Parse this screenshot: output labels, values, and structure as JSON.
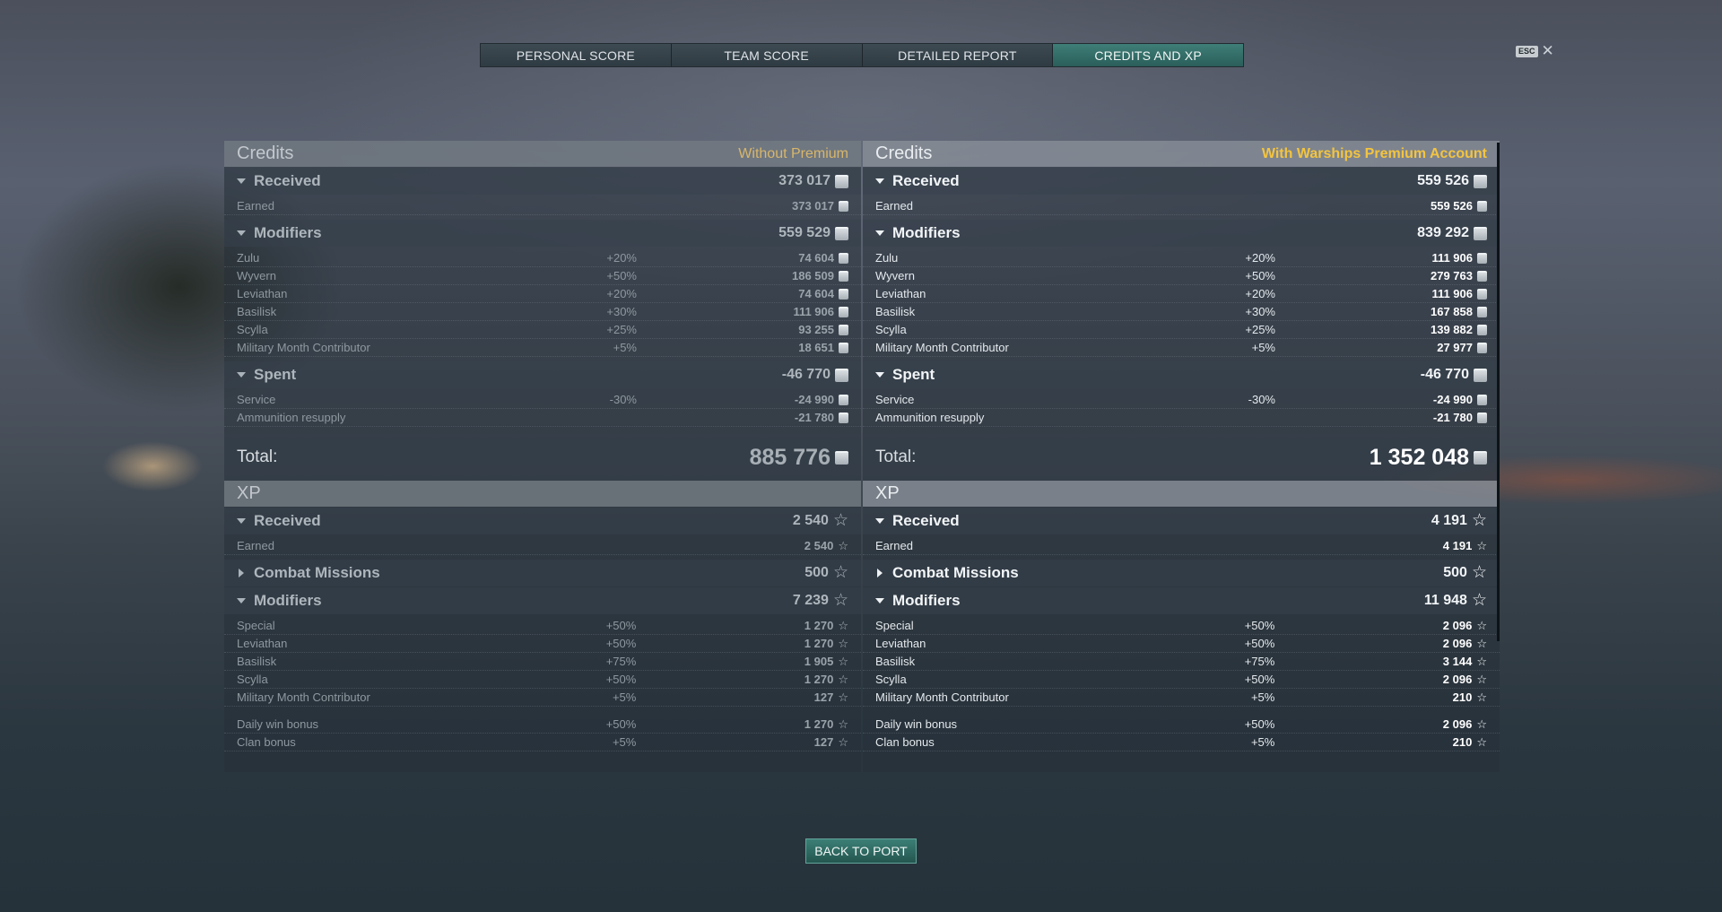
{
  "tabs": [
    {
      "label": "PERSONAL SCORE"
    },
    {
      "label": "TEAM SCORE"
    },
    {
      "label": "DETAILED REPORT"
    },
    {
      "label": "CREDITS AND XP"
    }
  ],
  "esc": {
    "key": "ESC",
    "close": "✕"
  },
  "left": {
    "credits_title": "Credits",
    "credits_note": "Without Premium",
    "received": {
      "label": "Received",
      "value": "373 017"
    },
    "earned": {
      "label": "Earned",
      "value": "373 017"
    },
    "modifiers": {
      "label": "Modifiers",
      "value": "559 529"
    },
    "mods": [
      {
        "label": "Zulu",
        "pct": "+20%",
        "value": "74 604"
      },
      {
        "label": "Wyvern",
        "pct": "+50%",
        "value": "186 509"
      },
      {
        "label": "Leviathan",
        "pct": "+20%",
        "value": "74 604"
      },
      {
        "label": "Basilisk",
        "pct": "+30%",
        "value": "111 906"
      },
      {
        "label": "Scylla",
        "pct": "+25%",
        "value": "93 255"
      },
      {
        "label": "Military Month Contributor",
        "pct": "+5%",
        "value": "18 651"
      }
    ],
    "spent": {
      "label": "Spent",
      "value": "-46 770"
    },
    "spent_rows": [
      {
        "label": "Service",
        "pct": "-30%",
        "value": "-24 990"
      },
      {
        "label": "Ammunition resupply",
        "pct": "",
        "value": "-21 780"
      }
    ],
    "total": {
      "label": "Total:",
      "value": "885 776"
    },
    "xp_title": "XP",
    "xp_received": {
      "label": "Received",
      "value": "2 540"
    },
    "xp_earned": {
      "label": "Earned",
      "value": "2 540"
    },
    "combat": {
      "label": "Combat Missions",
      "value": "500"
    },
    "xp_modifiers": {
      "label": "Modifiers",
      "value": "7 239"
    },
    "xp_mods": [
      {
        "label": "Special",
        "pct": "+50%",
        "value": "1 270"
      },
      {
        "label": "Leviathan",
        "pct": "+50%",
        "value": "1 270"
      },
      {
        "label": "Basilisk",
        "pct": "+75%",
        "value": "1 905"
      },
      {
        "label": "Scylla",
        "pct": "+50%",
        "value": "1 270"
      },
      {
        "label": "Military Month Contributor",
        "pct": "+5%",
        "value": "127"
      }
    ],
    "xp_bonus": [
      {
        "label": "Daily win bonus",
        "pct": "+50%",
        "value": "1 270"
      },
      {
        "label": "Clan bonus",
        "pct": "+5%",
        "value": "127"
      }
    ]
  },
  "right": {
    "credits_title": "Credits",
    "credits_note": "With Warships Premium Account",
    "received": {
      "label": "Received",
      "value": "559 526"
    },
    "earned": {
      "label": "Earned",
      "value": "559 526"
    },
    "modifiers": {
      "label": "Modifiers",
      "value": "839 292"
    },
    "mods": [
      {
        "label": "Zulu",
        "pct": "+20%",
        "value": "111 906"
      },
      {
        "label": "Wyvern",
        "pct": "+50%",
        "value": "279 763"
      },
      {
        "label": "Leviathan",
        "pct": "+20%",
        "value": "111 906"
      },
      {
        "label": "Basilisk",
        "pct": "+30%",
        "value": "167 858"
      },
      {
        "label": "Scylla",
        "pct": "+25%",
        "value": "139 882"
      },
      {
        "label": "Military Month Contributor",
        "pct": "+5%",
        "value": "27 977"
      }
    ],
    "spent": {
      "label": "Spent",
      "value": "-46 770"
    },
    "spent_rows": [
      {
        "label": "Service",
        "pct": "-30%",
        "value": "-24 990"
      },
      {
        "label": "Ammunition resupply",
        "pct": "",
        "value": "-21 780"
      }
    ],
    "total": {
      "label": "Total:",
      "value": "1 352 048"
    },
    "xp_title": "XP",
    "xp_received": {
      "label": "Received",
      "value": "4 191"
    },
    "xp_earned": {
      "label": "Earned",
      "value": "4 191"
    },
    "combat": {
      "label": "Combat Missions",
      "value": "500"
    },
    "xp_modifiers": {
      "label": "Modifiers",
      "value": "11 948"
    },
    "xp_mods": [
      {
        "label": "Special",
        "pct": "+50%",
        "value": "2 096"
      },
      {
        "label": "Leviathan",
        "pct": "+50%",
        "value": "2 096"
      },
      {
        "label": "Basilisk",
        "pct": "+75%",
        "value": "3 144"
      },
      {
        "label": "Scylla",
        "pct": "+50%",
        "value": "2 096"
      },
      {
        "label": "Military Month Contributor",
        "pct": "+5%",
        "value": "210"
      }
    ],
    "xp_bonus": [
      {
        "label": "Daily win bonus",
        "pct": "+50%",
        "value": "2 096"
      },
      {
        "label": "Clan bonus",
        "pct": "+5%",
        "value": "210"
      }
    ]
  },
  "back_button": "BACK TO PORT"
}
